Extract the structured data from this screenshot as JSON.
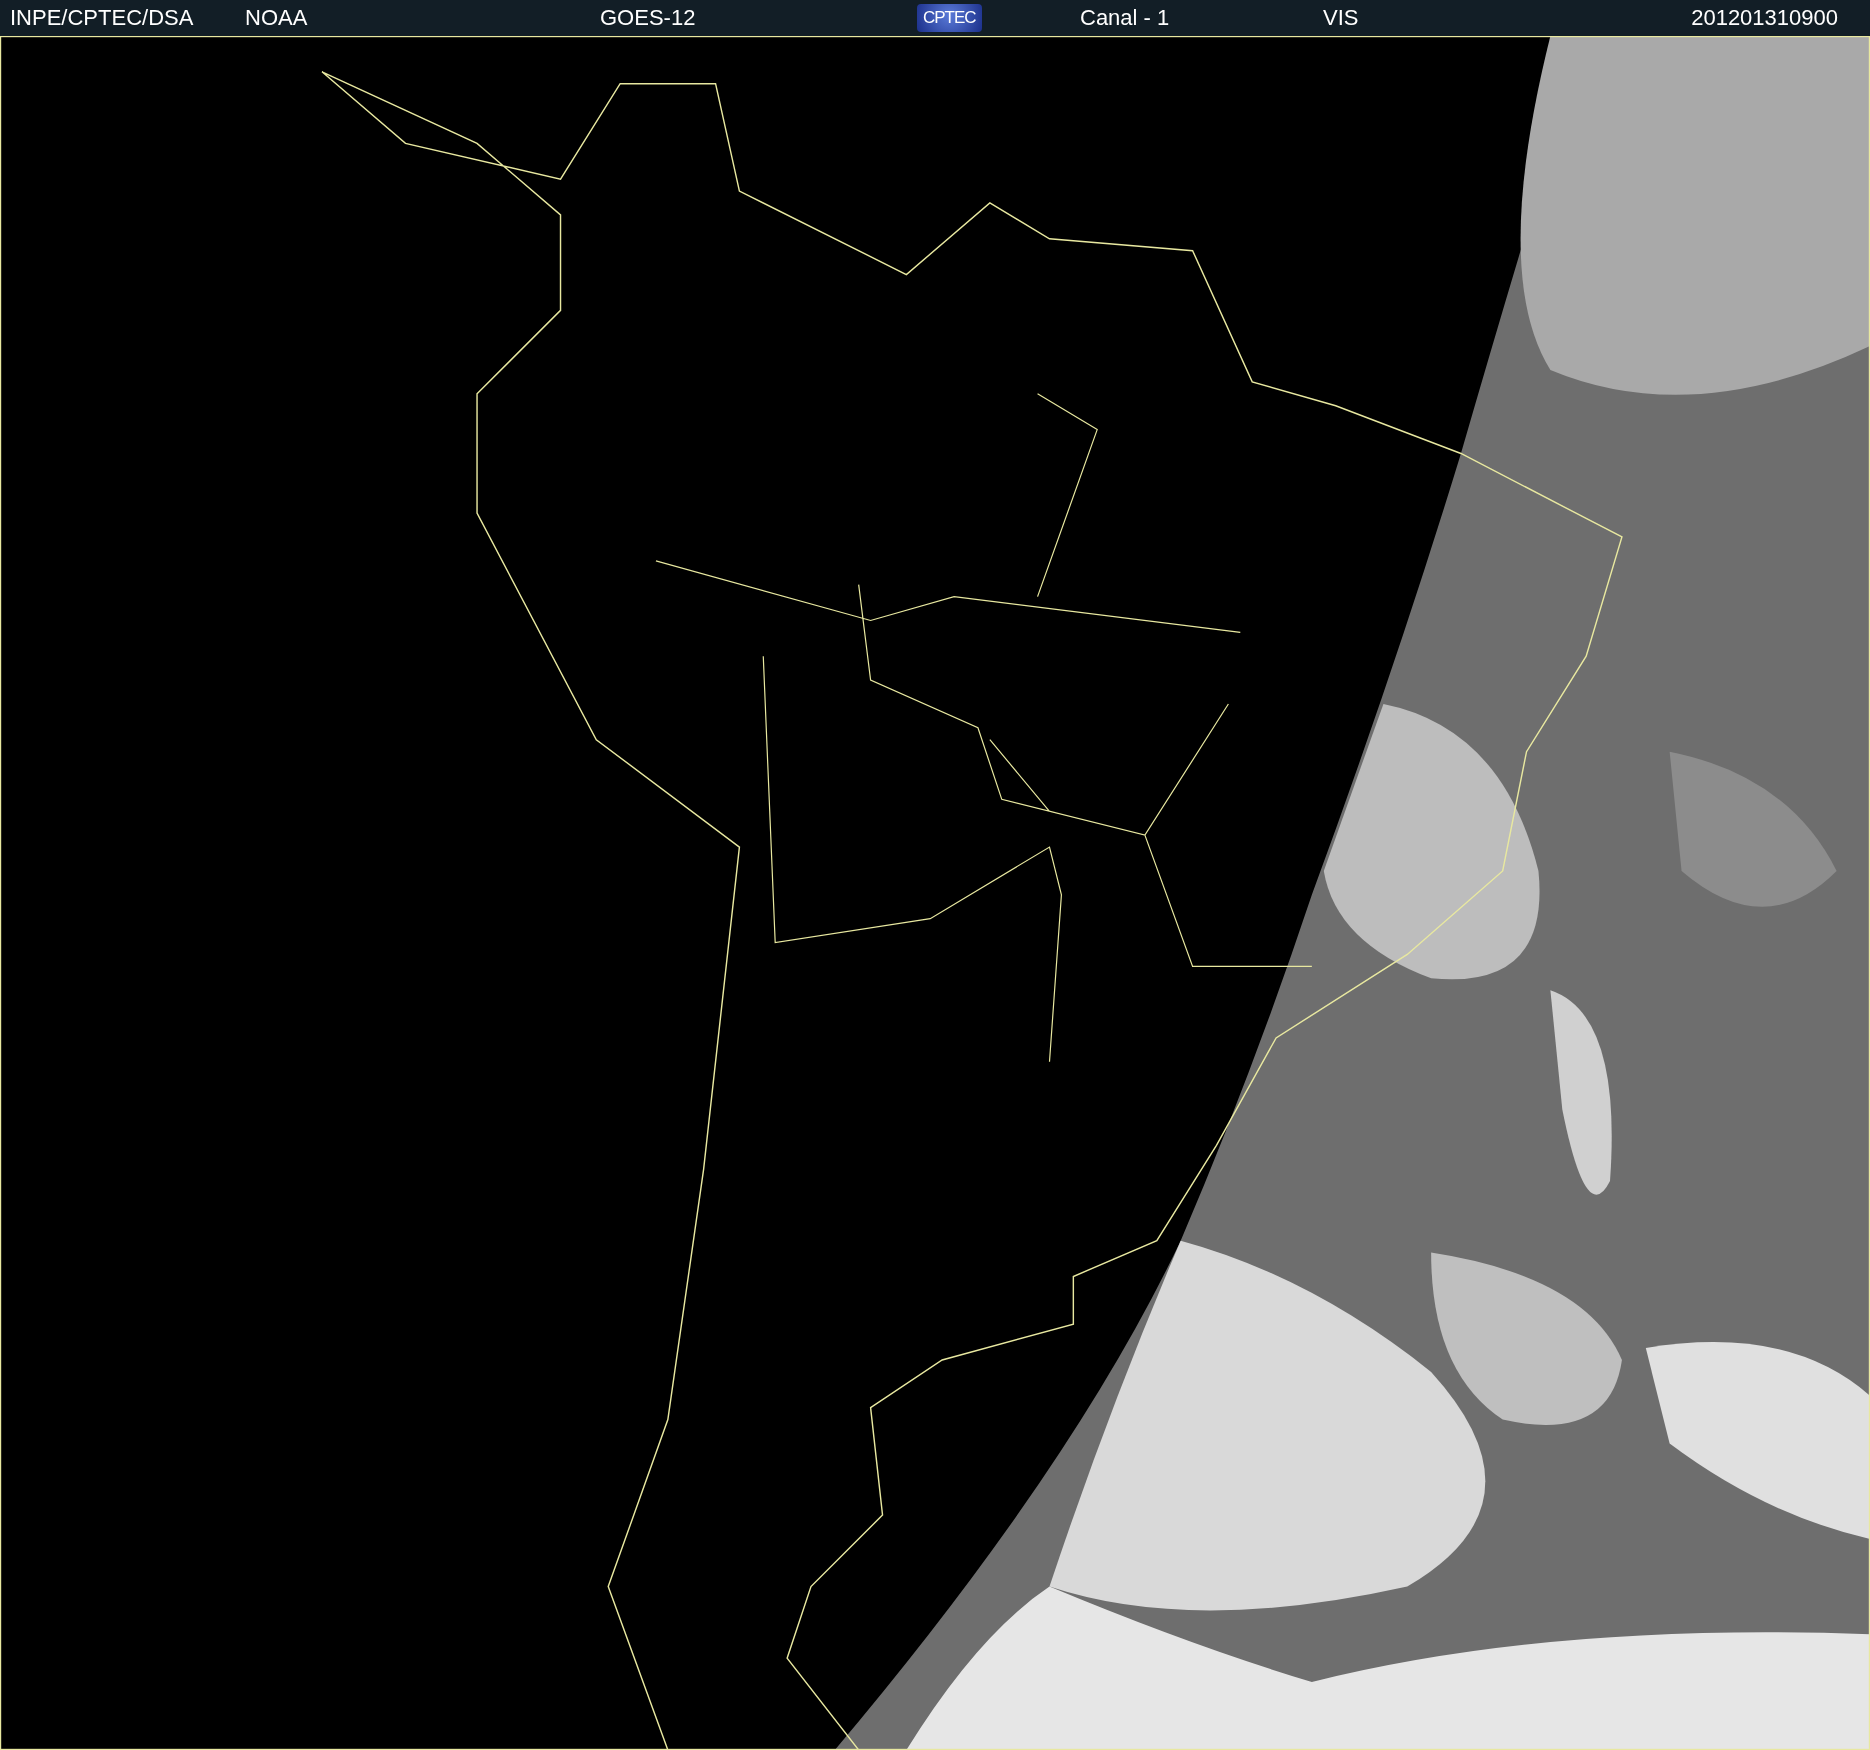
{
  "header": {
    "items": [
      {
        "kind": "text",
        "text": "INPE/CPTEC/DSA"
      },
      {
        "kind": "text",
        "text": "NOAA"
      },
      {
        "kind": "text",
        "text": "GOES-12"
      },
      {
        "kind": "logo",
        "text": "CPTEC"
      },
      {
        "kind": "text",
        "text": "Canal - 1"
      },
      {
        "kind": "text",
        "text": "VIS"
      },
      {
        "kind": "text",
        "text": "201201310900"
      }
    ]
  }
}
